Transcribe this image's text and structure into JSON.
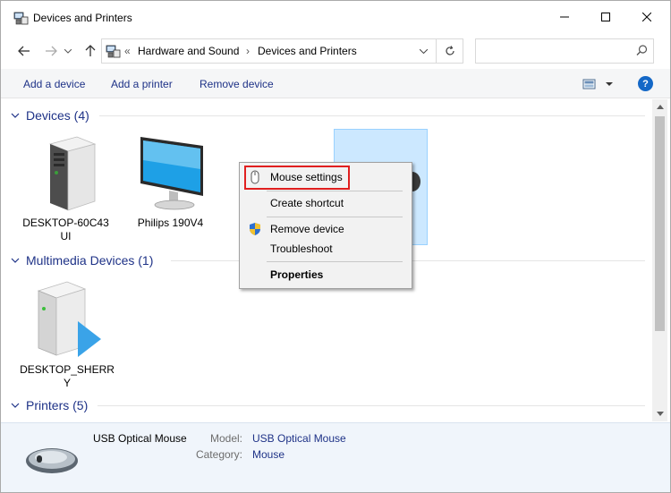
{
  "window": {
    "title": "Devices and Printers"
  },
  "address": {
    "crumbs": [
      "Hardware and Sound",
      "Devices and Printers"
    ],
    "separator": "›",
    "root_sep": "«"
  },
  "search": {
    "placeholder": ""
  },
  "toolbar": {
    "add_device": "Add a device",
    "add_printer": "Add a printer",
    "remove_device": "Remove device",
    "help": "?"
  },
  "groups": {
    "devices": {
      "title": "Devices (4)"
    },
    "multimedia": {
      "title": "Multimedia Devices (1)"
    },
    "printers": {
      "title": "Printers (5)"
    }
  },
  "devices": [
    {
      "label_line1": "DESKTOP-60C43",
      "label_line2": "UI"
    },
    {
      "label_line1": "Philips 190V4",
      "label_line2": ""
    }
  ],
  "multimedia": [
    {
      "label_line1": "DESKTOP_SHERR",
      "label_line2": "Y"
    }
  ],
  "context_menu": {
    "mouse_settings": "Mouse settings",
    "create_shortcut": "Create shortcut",
    "remove_device": "Remove device",
    "troubleshoot": "Troubleshoot",
    "properties": "Properties"
  },
  "details": {
    "name": "USB Optical Mouse",
    "model_key": "Model:",
    "model_value": "USB Optical Mouse",
    "category_key": "Category:",
    "category_value": "Mouse"
  },
  "colors": {
    "accent": "#1e3287",
    "selection": "#cce8ff",
    "highlight_border": "#e01f1f",
    "help": "#1468c7"
  },
  "icons": [
    "devices-printers-icon",
    "minimize-icon",
    "maximize-icon",
    "close-icon",
    "back-arrow-icon",
    "forward-arrow-icon",
    "up-arrow-icon",
    "chevron-down-icon",
    "refresh-icon",
    "search-icon",
    "view-options-icon",
    "help-icon",
    "computer-tower-icon",
    "monitor-icon",
    "mouse-icon",
    "shield-icon",
    "media-device-icon"
  ]
}
